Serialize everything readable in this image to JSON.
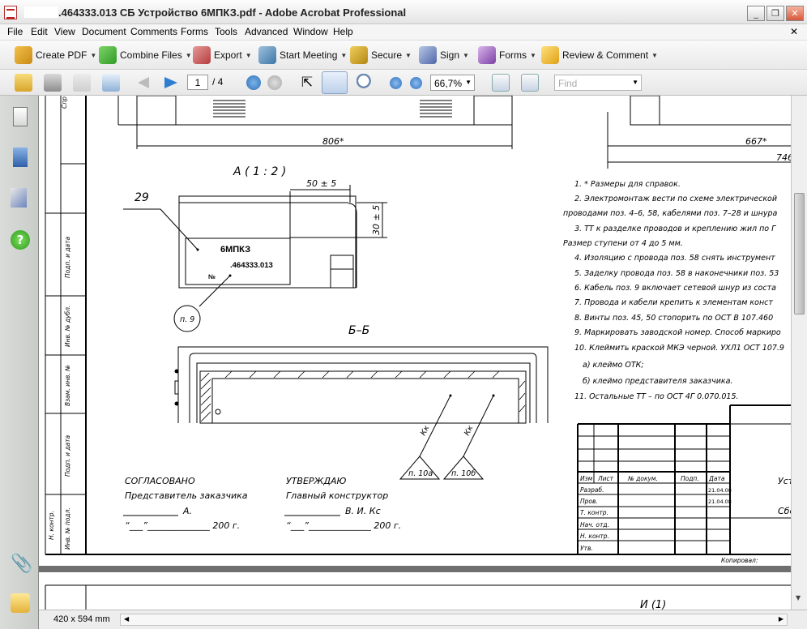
{
  "window": {
    "title": ".464333.013 СБ Устройство 6МПКЗ.pdf - Adobe Acrobat Professional",
    "minimize": "_",
    "restore": "❐",
    "close": "✕",
    "doc_close": "✕"
  },
  "menu": [
    "File",
    "Edit",
    "View",
    "Document",
    "Comments",
    "Forms",
    "Tools",
    "Advanced",
    "Window",
    "Help"
  ],
  "toolbar": {
    "create_pdf": "Create PDF",
    "combine_files": "Combine Files",
    "export": "Export",
    "start_meeting": "Start Meeting",
    "secure": "Secure",
    "sign": "Sign",
    "forms": "Forms",
    "review_comment": "Review & Comment"
  },
  "nav": {
    "page_current": "1",
    "page_total": "/ 4",
    "zoom": "66,7%",
    "find_placeholder": "Find"
  },
  "colors": {
    "accent": "#2b6fc0",
    "nav_bg": "#cfd1cd",
    "status_bg": "#ededed"
  },
  "drawing": {
    "dim_806": "806*",
    "dim_667": "667*",
    "dim_746": "746",
    "view_a": "А  ( 1 : 2 )",
    "dim_50": "50 ± 5",
    "dim_30": "30 ± 5",
    "pos_29": "29",
    "plate_title": "6МПКЗ",
    "plate_code": ".464333.013",
    "plate_no": "№",
    "ref_p9": "п. 9",
    "section_bb": "Б–Б",
    "kk1": "Кк",
    "kk2": "Кк",
    "ref_p10a": "п. 10а",
    "ref_p10b": "п. 10б",
    "notes": [
      "1. * Размеры для справок.",
      "2. Электромонтаж вести по схеме электрической",
      "проводами поз. 4–6, 58, кабелями поз. 7–28 и шнура",
      "3. ТТ к разделке проводов и креплению жил по Г",
      "Размер ступени от 4 до 5 мм.",
      "4. Изоляцию с провода поз. 58 снять инструмент",
      "5. Заделку провода поз. 58 в наконечники поз. 53",
      "6. Кабель поз. 9 включает сетевой шнур из соста",
      "7. Провода и кабели крепить к элементам конст",
      "8. Винты поз. 45, 50 стопорить по ОСТ В 107.460",
      "9. Маркировать заводской номер. Способ маркиро",
      "10. Клеймить краской МКЭ черной. УХЛ1 ОСТ 107.9",
      "а) клеймо ОТК;",
      "б) клеймо представителя заказчика.",
      "11. Остальные ТТ – по ОСТ 4Г 0.070.015."
    ],
    "approval_left": [
      "СОГЛАСОВАНО",
      "Представитель заказчика",
      "А.",
      "“___”______________ 200   г."
    ],
    "approval_right": [
      "УТВЕРЖДАЮ",
      "Главный конструктор",
      "В. И. Кс",
      "“___”______________ 200   г."
    ],
    "side_labels": [
      "Подп. и дата",
      "Инв. № дубл.",
      "Взам. инв. №",
      "Подп. и дата",
      "Инв. № подл.",
      "Н. контр.",
      "Спр"
    ],
    "stamp_header": [
      "Изм",
      "Лист",
      "№ докум.",
      "Подп.",
      "Дата"
    ],
    "stamp_rows": [
      "Разраб.",
      "Пров.",
      "Т. контр.",
      "Нач. отд.",
      "Н. контр.",
      "Утв."
    ],
    "stamp_dates": [
      "21.04.08",
      "21.04.08"
    ],
    "stamp_right1": "Уст",
    "stamp_right2": "Сбо",
    "copied": "Копировал:",
    "next_page_label": "И (1)"
  },
  "status": {
    "page_size": "420 x 594 mm"
  }
}
